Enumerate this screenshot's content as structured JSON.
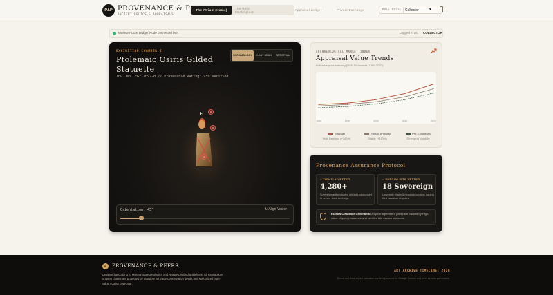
{
  "header": {
    "logo_text": "P&P",
    "brand_title": "PROVENANCE & PEERS",
    "brand_subtitle": "ANCIENT RELICS & APPRAISALS",
    "nav": [
      "The Atrium (Home)",
      "The Relic Marketplace",
      "Appraisal Ledger",
      "Private Exchange"
    ],
    "active_nav": 0,
    "role_label": "ROLE MODE:",
    "role_value": "Collector"
  },
  "status": {
    "message": "Museum-Core Ledger Node connected live.",
    "logged_label": "Logged in as:",
    "logged_role": "COLLECTOR",
    "dot_color": "#3fb676"
  },
  "chamber": {
    "label": "EXHIBITION CHAMBER I",
    "title_line1": "Ptolemaic Osiris Gilded",
    "title_line2": "Statuette",
    "inventory": "Inv. No. EGY-3092-B // Provenance Rating: 95% Verified",
    "modes": [
      "CHROMOLOGY",
      "X-RAY SCAN",
      "SPECTRAL"
    ],
    "active_mode": 0,
    "orientation_label": "Orientation: 45°",
    "orientation_deg": 45,
    "align_label": "Align Vector"
  },
  "trends": {
    "label": "ARCHAEOLOGICAL MARKET INDEX",
    "title": "Appraisal Value Trends",
    "subtitle": "Indicative price indexing (USD Thousands, 1980-2020)",
    "icon": "trend-up-icon"
  },
  "chart_data": {
    "type": "line",
    "x": [
      1980,
      1990,
      2000,
      2010,
      2020
    ],
    "series": [
      {
        "name": "Egyptian",
        "values": [
          40,
          45,
          58,
          80,
          115
        ],
        "color": "#b5553c"
      },
      {
        "name": "Roman Antiquity",
        "values": [
          35,
          40,
          50,
          68,
          98
        ],
        "color": "#8a7b6a"
      },
      {
        "name": "Pre-Columbian",
        "values": [
          28,
          33,
          42,
          58,
          82
        ],
        "color": "#3b5b4a"
      }
    ],
    "ylim": [
      0,
      150
    ],
    "xlabel": "",
    "ylabel": "",
    "legend": [
      {
        "name": "Egyptian",
        "note": "High Demand (+140%)"
      },
      {
        "name": "Roman Antiquity",
        "note": "Stable (+110%)"
      },
      {
        "name": "Pre-Columbian",
        "note": "Emerging Volatility"
      }
    ]
  },
  "assurance": {
    "title": "Provenance Assurance Protocol",
    "stat1": {
      "label": "TIGHTLY VETTED",
      "value": "4,280+",
      "desc": "Sovereign authenticated artifacts catalogued in secure state cold-logs."
    },
    "stat2": {
      "label": "SPECIALISTS VETTED",
      "value": "18 Sovereign",
      "desc": "University chairs & museum curators issuing tiled valuation disputes."
    },
    "escrow_title": "Escrow Clearance Covenants:",
    "escrow_text": "All price agreement points are backed by High-value shipping insurance and certified title escrow protocols."
  },
  "footer": {
    "logo_text": "P",
    "brand": "PROVENANCE & PEERS",
    "text": "Designed according to Museumcore aesthetics and Nature Distilled guidelines. All transactions on peer chains are protected by statutory art trade conservation deeds and specialized high-value courier coverage.",
    "timeline": "ART ARCHIVE TIMELINE: 2026",
    "credits": "Direct and third-expert valuation context powered by Google Gemini and peer scholar panoramic."
  }
}
